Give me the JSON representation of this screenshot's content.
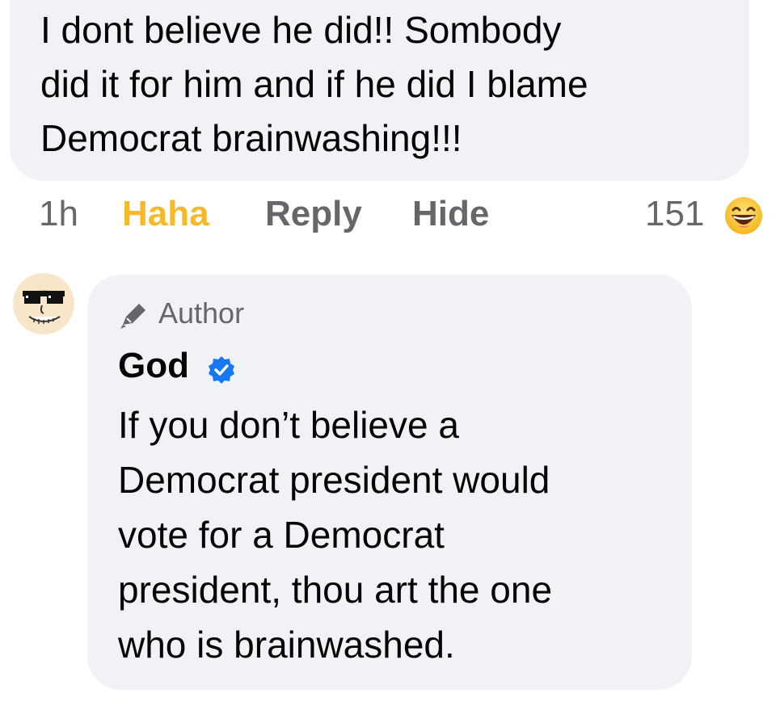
{
  "previous_comment": {
    "text": "I dont believe he did!! Sombody\ndid it for him and if he did I blame\nDemocrat brainwashing!!!"
  },
  "previous_comment_actions": {
    "time": "1h",
    "reaction_label": "Haha",
    "reaction_color": "#f7b928",
    "reply_label": "Reply",
    "hide_label": "Hide",
    "reaction_count": "151",
    "reaction_icon": "laughing-emoji-icon"
  },
  "reply_comment": {
    "badge_icon": "pencil-icon",
    "badge_label": "Author",
    "author_name": "God",
    "verified_icon": "verified-badge-icon",
    "verified_color": "#1877f2",
    "text": "If you don’t believe a\nDemocrat president would\nvote for a Democrat\npresident, thou art the one\nwho is brainwashed."
  },
  "colors": {
    "bubble_background": "#f0f2f5",
    "secondary_text": "#65676b",
    "primary_text": "#050505"
  }
}
